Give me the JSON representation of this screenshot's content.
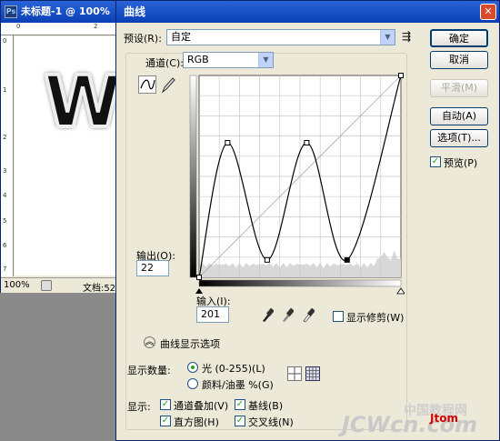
{
  "document_window": {
    "ps_icon": "Ps",
    "title": "未标题-1 @ 100%",
    "ruler_top": [
      "0",
      "2"
    ],
    "ruler_left": [
      "0",
      "1",
      "2",
      "3",
      "4",
      "5",
      "6",
      "7"
    ],
    "letter": "W",
    "zoom": "100%",
    "status": "文档:52"
  },
  "dialog": {
    "title": "曲线",
    "close_glyph": "✕",
    "preset_label": "预设(R):",
    "preset_value": "自定",
    "preset_menu_glyph": "⇶",
    "channel_label": "通道(C):",
    "channel_value": "RGB",
    "combo_arrow": "▼",
    "buttons": {
      "ok": "确定",
      "cancel": "取消",
      "smooth": "平滑(M)",
      "auto": "自动(A)",
      "options": "选项(T)..."
    },
    "preview_label": "预览(P)",
    "preview_checked": true,
    "output_label": "输出(O):",
    "output_value": "22",
    "input_label": "输入(I):",
    "input_value": "201",
    "show_clipping_label": "显示修剪(W)",
    "show_clipping_checked": false,
    "curve_options_label": "曲线显示选项",
    "expand_glyph": "︽",
    "show_amount_label": "显示数量:",
    "light_option": "光 (0-255)(L)",
    "pigment_option": "颜料/油墨 %(G)",
    "light_selected": true,
    "show_label": "显示:",
    "checkbox_glyph": "✓",
    "show_options": [
      {
        "label": "通道叠加(V)",
        "checked": true
      },
      {
        "label": "基线(B)",
        "checked": true
      },
      {
        "label": "直方图(H)",
        "checked": true
      },
      {
        "label": "交叉线(N)",
        "checked": true
      }
    ]
  },
  "curve": {
    "type": "line",
    "xlim": [
      0,
      255
    ],
    "ylim": [
      0,
      255
    ],
    "control_points": [
      [
        0,
        0
      ],
      [
        36,
        170
      ],
      [
        86,
        22
      ],
      [
        136,
        170
      ],
      [
        187,
        22
      ],
      [
        255,
        255
      ]
    ],
    "selected_point_index": 4
  },
  "watermark": {
    "line1": "中国教程网",
    "line2": "JCWcn.com",
    "tag": "Jtom"
  }
}
